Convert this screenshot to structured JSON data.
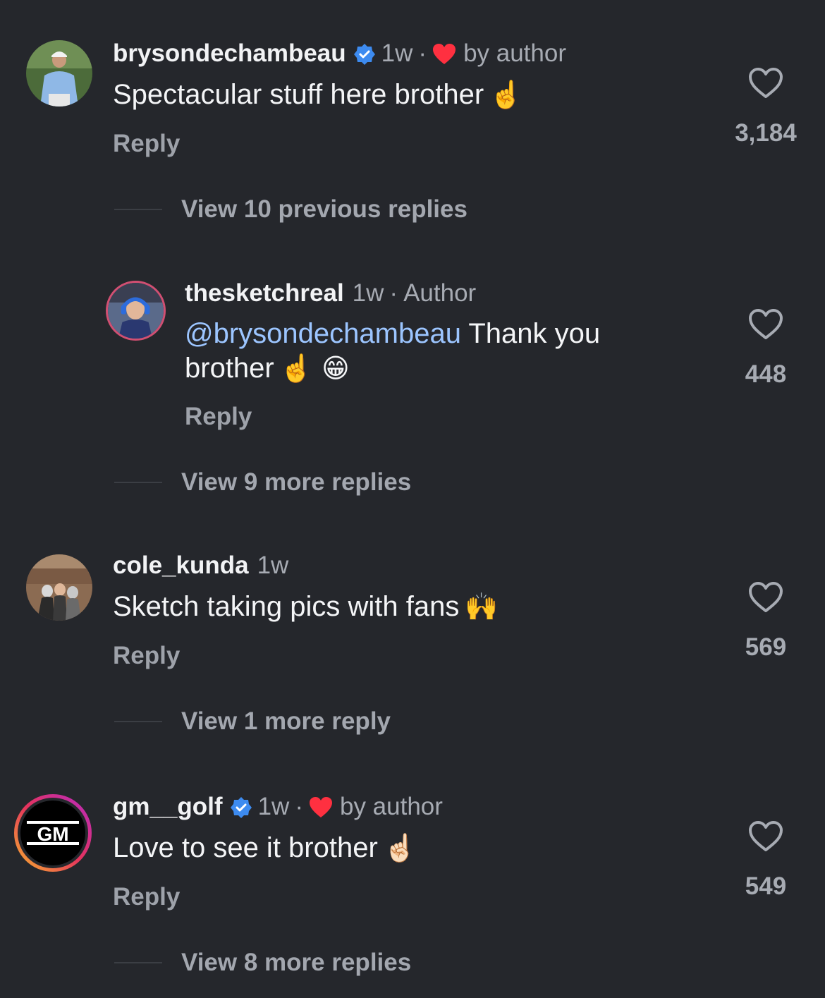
{
  "comments": [
    {
      "username": "brysondechambeau",
      "verified": true,
      "time": "1w",
      "liked_by_author": true,
      "by_author_label": "by author",
      "text": "Spectacular stuff here brother",
      "emoji": "☝️",
      "reply_label": "Reply",
      "like_count": "3,184",
      "view_replies": "View 10 previous replies"
    },
    {
      "username": "thesketchreal",
      "time": "1w",
      "author_label": "Author",
      "mention": "@brysondechambeau",
      "text_line1": " Thank you",
      "text_line2": "brother",
      "emoji": "☝️ 😁",
      "reply_label": "Reply",
      "like_count": "448",
      "view_replies": "View 9 more replies"
    },
    {
      "username": "cole_kunda",
      "time": "1w",
      "text": "Sketch taking pics with fans",
      "emoji": "🙌",
      "reply_label": "Reply",
      "like_count": "569",
      "view_replies": "View 1 more reply"
    },
    {
      "username": "gm__golf",
      "verified": true,
      "time": "1w",
      "liked_by_author": true,
      "by_author_label": "by author",
      "text": "Love to see it brother",
      "emoji": "☝🏻",
      "reply_label": "Reply",
      "like_count": "549",
      "view_replies": "View 8 more replies"
    }
  ],
  "icons": {
    "verified": "verified-badge-icon",
    "author_heart": "red-heart-icon",
    "like": "heart-outline-icon"
  },
  "colors": {
    "background": "#25272c",
    "verified": "#3d8bf0",
    "heart_red": "#ff3040",
    "mention": "#9cc5ff"
  },
  "avatar_logo_text": "GM"
}
